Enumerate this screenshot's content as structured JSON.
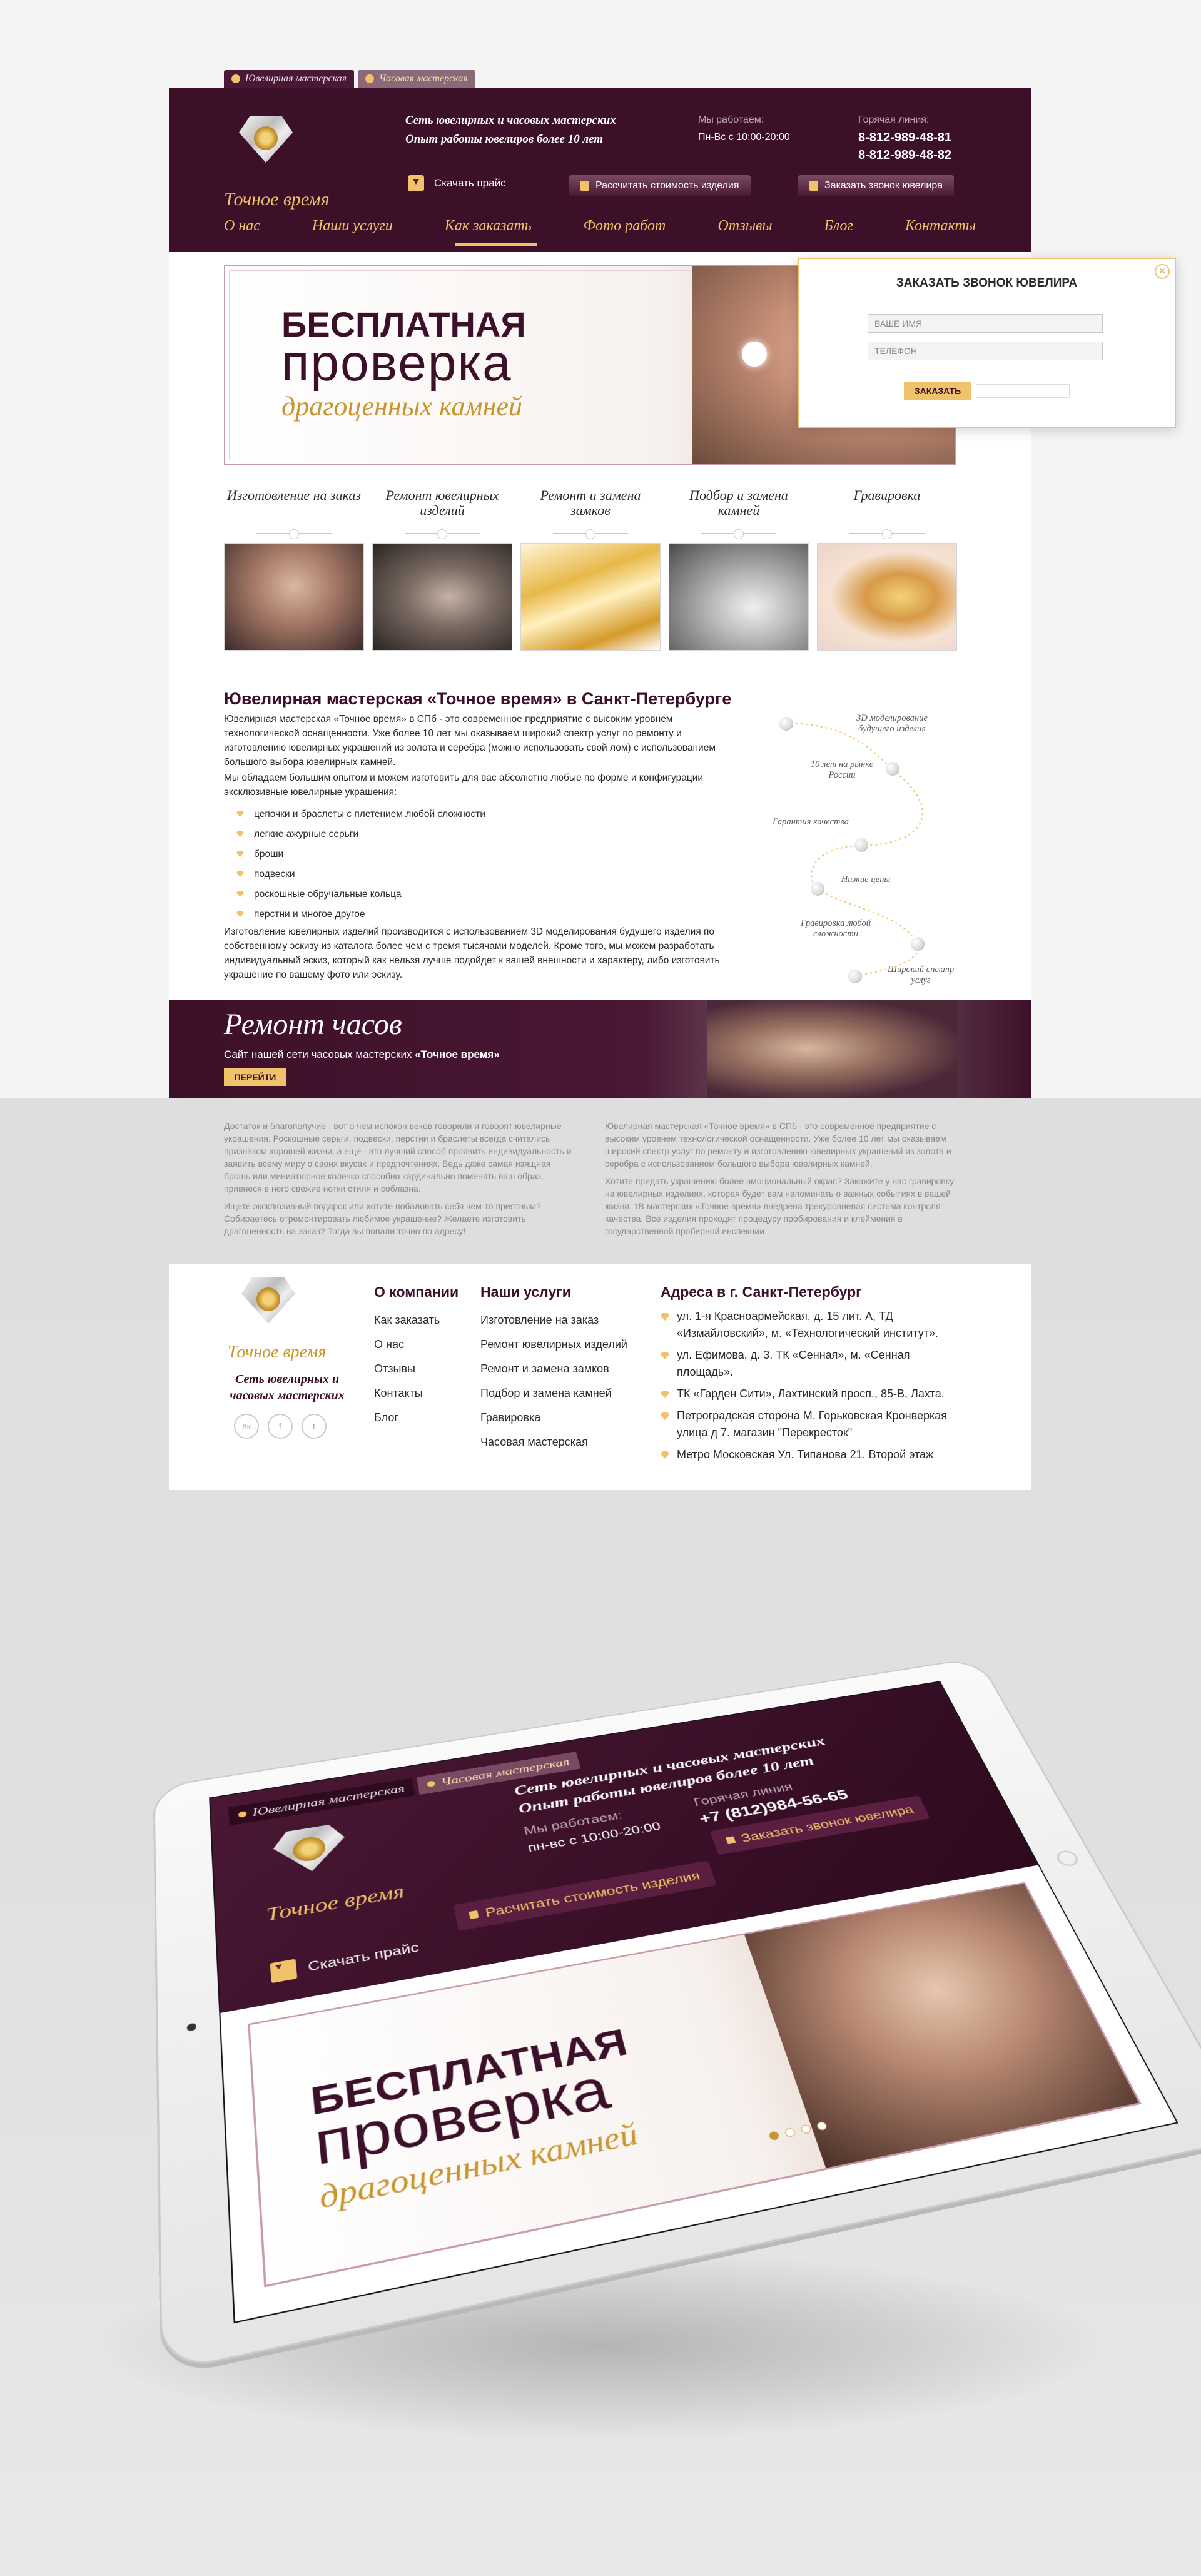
{
  "tabs": {
    "jewelry": "Ювелирная мастерская",
    "watch": "Часовая мастерская"
  },
  "header": {
    "logo_text": "Точное время",
    "tagline_1": "Сеть ювелирных и часовых мастерских",
    "tagline_2": "Опыт работы ювелиров более 10 лет",
    "work_label": "Мы работаем:",
    "work_hours": "Пн-Вс с 10:00-20:00",
    "hotline_label": "Горячая линия:",
    "phone_1": "8-812-989-48-81",
    "phone_2": "8-812-989-48-82",
    "price_label": "Скачать прайс",
    "calc_label": "Рассчитать стоимость изделия",
    "call_label": "Заказать звонок ювелира"
  },
  "nav": [
    "О нас",
    "Наши услуги",
    "Как заказать",
    "Фото работ",
    "Отзывы",
    "Блог",
    "Контакты"
  ],
  "banner": {
    "line1": "БЕСПЛАТНАЯ",
    "line2": "проверка",
    "line3": "драгоценных камней"
  },
  "popup": {
    "title": "ЗАКАЗАТЬ ЗВОНОК ЮВЕЛИРА",
    "name_placeholder": "ВАШЕ ИМЯ",
    "phone_placeholder": "ТЕЛЕФОН",
    "submit": "ЗАКАЗАТЬ"
  },
  "services": [
    {
      "title": "Изготовление на заказ"
    },
    {
      "title": "Ремонт ювелирных изделий"
    },
    {
      "title": "Ремонт и замена замков"
    },
    {
      "title": "Подбор и замена камней"
    },
    {
      "title": "Гравировка"
    }
  ],
  "about": {
    "title": "Ювелирная мастерская «Точное время» в Санкт-Петербурге",
    "p1": "Ювелирная мастерская «Точное время» в СПб - это современное предприятие с высоким уровнем технологической оснащенности. Уже более 10 лет мы оказываем широкий спектр услуг по ремонту и изготовлению ювелирных украшений из золота и серебра (можно использовать свой лом) с использованием большого выбора ювелирных камней.",
    "p2": "Мы обладаем большим опытом и можем изготовить для вас абсолютно любые по форме и конфигурации эксклюзивные ювелирные украшения:",
    "list": [
      "цепочки и браслеты с плетением любой сложности",
      "легкие ажурные серьги",
      "броши",
      "подвески",
      "роскошные обручальные кольца",
      "перстни и многое другое"
    ],
    "p3": "Изготовление ювелирных изделий производится с использованием 3D моделирования будущего изделия по собственному эскизу из каталога более чем с тремя тысячами моделей. Кроме того, мы можем разработать индивидуальный эскиз, который как нельзя лучше подойдет к вашей внешности и характеру, либо изготовить украшение по вашему фото или эскизу."
  },
  "timeline": [
    "3D моделирование будущего изделия",
    "10 лет на рынке России",
    "Гарантия качества",
    "Низкие цены",
    "Гравировка любой сложности",
    "Широкий спектр услуг"
  ],
  "watch_repair": {
    "title": "Ремонт часов",
    "subtitle_prefix": "Сайт нашей сети часовых мастерских ",
    "subtitle_name": "«Точное время»",
    "button": "ПЕРЕЙТИ"
  },
  "seo": {
    "left_1": "Достаток и благополучие - вот о чем испокон веков говорили и говорят ювелирные украшения. Роскошные серьги, подвески, перстни и браслеты всегда считались признаком хорошей жизни, а еще - это лучший способ проявить индивидуальность и заявить всему миру о своих вкусах и предпочтениях. Ведь даже самая изящная брошь или миниатюрное колечко способно кардинально поменять ваш образ, привнеся в него свежие нотки стиля и соблазна.",
    "left_2": "Ищете эксклюзивный подарок или хотите побаловать себя чем-то приятным? Собираетесь отремонтировать любимое украшение? Желаете изготовить драгоценность на заказ? Тогда вы попали точно по адресу!",
    "right_1": "Ювелирная мастерская «Точное время» в СПб - это современное предприятие с высоким уровнем технологической оснащенности. Уже более 10 лет мы оказываем широкий спектр услуг по ремонту и изготовлению ювелирных украшений из золота и серебра с использованием большого выбора ювелирных камней.",
    "right_2": "Хотите придать украшению более эмоциональный окрас? Закажите у нас гравировку на ювелирных изделиях, которая будет вам напоминать о важных событиях в вашей жизни. тВ мастерских «Точное время» внедрена трехуровневая система контроля качества. Все изделия проходят процедуру пробирования и клеймения в государственной пробирной инспекции."
  },
  "footer": {
    "logo_text": "Точное время",
    "tagline": "Сеть ювелирных и часовых мастерских",
    "socials": [
      "вк",
      "f",
      "t"
    ],
    "company_title": "О компании",
    "company_links": [
      "Как заказать",
      "О нас",
      "Отзывы",
      "Контакты",
      "Блог"
    ],
    "services_title": "Наши услуги",
    "services_links": [
      "Изготовление на заказ",
      "Ремонт ювелирных изделий",
      "Ремонт и замена замков",
      "Подбор и замена камней",
      "Гравировка",
      "Часовая мастерская"
    ],
    "addr_title": "Адреса в г. Санкт-Петербург",
    "addresses": [
      "ул. 1-я Красноармейская, д. 15 лит. А, ТД «Измайловский», м. «Технологический институт».",
      "ул. Ефимова, д. 3. ТК «Сенная», м. «Сенная площадь».",
      "ТК «Гарден Сити», Лахтинский просп., 85-В, Лахта.",
      "Петроградская сторона М. Горьковская Кронверкая улица д 7. магазин \"Перекресток\"",
      "Метро Московская Ул. Типанова 21. Второй этаж"
    ]
  },
  "tablet": {
    "tab_jewelry": "Ювелирная мастерская",
    "tab_watch": "Часовая мастерская",
    "logo_text": "Точное время",
    "tagline_1": "Сеть ювелирных и часовых мастерских",
    "tagline_2": "Опыт работы ювелиров более 10 лет",
    "work_label": "Мы работаем:",
    "work_hours": "пн-вс с 10:00-20:00",
    "hotline_label": "Горячая линия",
    "phone": "+7 (812)984-56-65",
    "call_label": "Заказать звонок ювелира",
    "calc_label": "Расчитать стоимость изделия",
    "price_label": "Скачать прайс",
    "banner_1": "БЕСПЛАТНАЯ",
    "banner_2": "проверка",
    "banner_3": "драгоценных камней"
  },
  "colors": {
    "brand": "#3d1029",
    "accent": "#f0c26a",
    "gold_text": "#c8952e"
  },
  "icons": [
    "gem-icon",
    "clock-icon",
    "download-icon",
    "calculator-icon",
    "phone-icon",
    "close-icon",
    "vk-icon",
    "facebook-icon",
    "twitter-icon"
  ]
}
